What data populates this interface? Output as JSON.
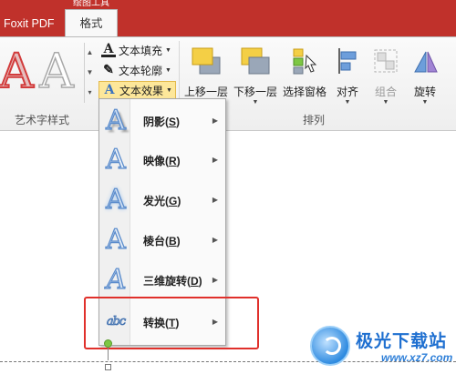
{
  "title_bar": {
    "context_group": "绘图工具",
    "tabs": [
      {
        "label": "Foxit PDF"
      },
      {
        "label": "格式"
      }
    ]
  },
  "ribbon": {
    "wordart_group": {
      "label": "艺术字样式",
      "commands": [
        {
          "label": "文本填充",
          "icon": "text-fill-icon"
        },
        {
          "label": "文本轮廓",
          "icon": "text-outline-icon"
        },
        {
          "label": "文本效果",
          "icon": "text-effects-icon",
          "active": true
        }
      ]
    },
    "arrange_group": {
      "label": "排列",
      "buttons": [
        {
          "label": "上移一层",
          "has_dropdown": true,
          "icon": "bring-forward-icon"
        },
        {
          "label": "下移一层",
          "has_dropdown": true,
          "icon": "send-backward-icon"
        },
        {
          "label": "选择窗格",
          "has_dropdown": false,
          "icon": "selection-pane-icon"
        },
        {
          "label": "对齐",
          "has_dropdown": true,
          "icon": "align-icon"
        },
        {
          "label": "组合",
          "has_dropdown": true,
          "icon": "group-icon",
          "disabled": true
        },
        {
          "label": "旋转",
          "has_dropdown": true,
          "icon": "rotate-icon"
        }
      ]
    }
  },
  "text_effects_menu": {
    "items": [
      {
        "label": "阴影(",
        "key": "S",
        "suffix": ")",
        "icon": "shadow-effect-icon"
      },
      {
        "label": "映像(",
        "key": "R",
        "suffix": ")",
        "icon": "reflection-effect-icon"
      },
      {
        "label": "发光(",
        "key": "G",
        "suffix": ")",
        "icon": "glow-effect-icon"
      },
      {
        "label": "棱台(",
        "key": "B",
        "suffix": ")",
        "icon": "bevel-effect-icon"
      },
      {
        "label": "三维旋转(",
        "key": "D",
        "suffix": ")",
        "icon": "3d-rotation-effect-icon"
      },
      {
        "label": "转换(",
        "key": "T",
        "suffix": ")",
        "icon": "transform-effect-icon",
        "icon_text": "abc",
        "highlighted": true
      }
    ]
  },
  "watermark": {
    "title": "极光下载站",
    "url": "www.xz7.com"
  },
  "colors": {
    "title_bar": "#c0312b",
    "active_command": "#fde79a",
    "highlight_box": "#e0302b",
    "watermark": "#1e6fd0"
  }
}
